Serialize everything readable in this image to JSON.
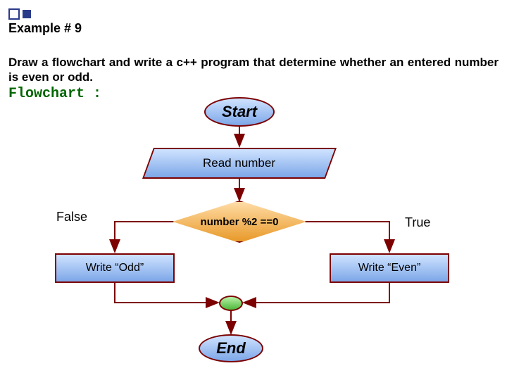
{
  "title": "Example # 9",
  "description": "Draw a flowchart and write a c++ program that determine whether an entered number is even or odd.",
  "flowchart_label": "Flowchart :",
  "nodes": {
    "start": "Start",
    "read": "Read number",
    "decision": "number %2 ==0",
    "false_label": "False",
    "true_label": "True",
    "write_odd": "Write “Odd”",
    "write_even": "Write “Even”",
    "end": "End"
  },
  "colors": {
    "terminator_fill": "#7da7e8",
    "io_fill": "#7da7e8",
    "decision_fill": "#e89a2a",
    "connector_fill": "#4eb83a",
    "border": "#7c0000"
  }
}
